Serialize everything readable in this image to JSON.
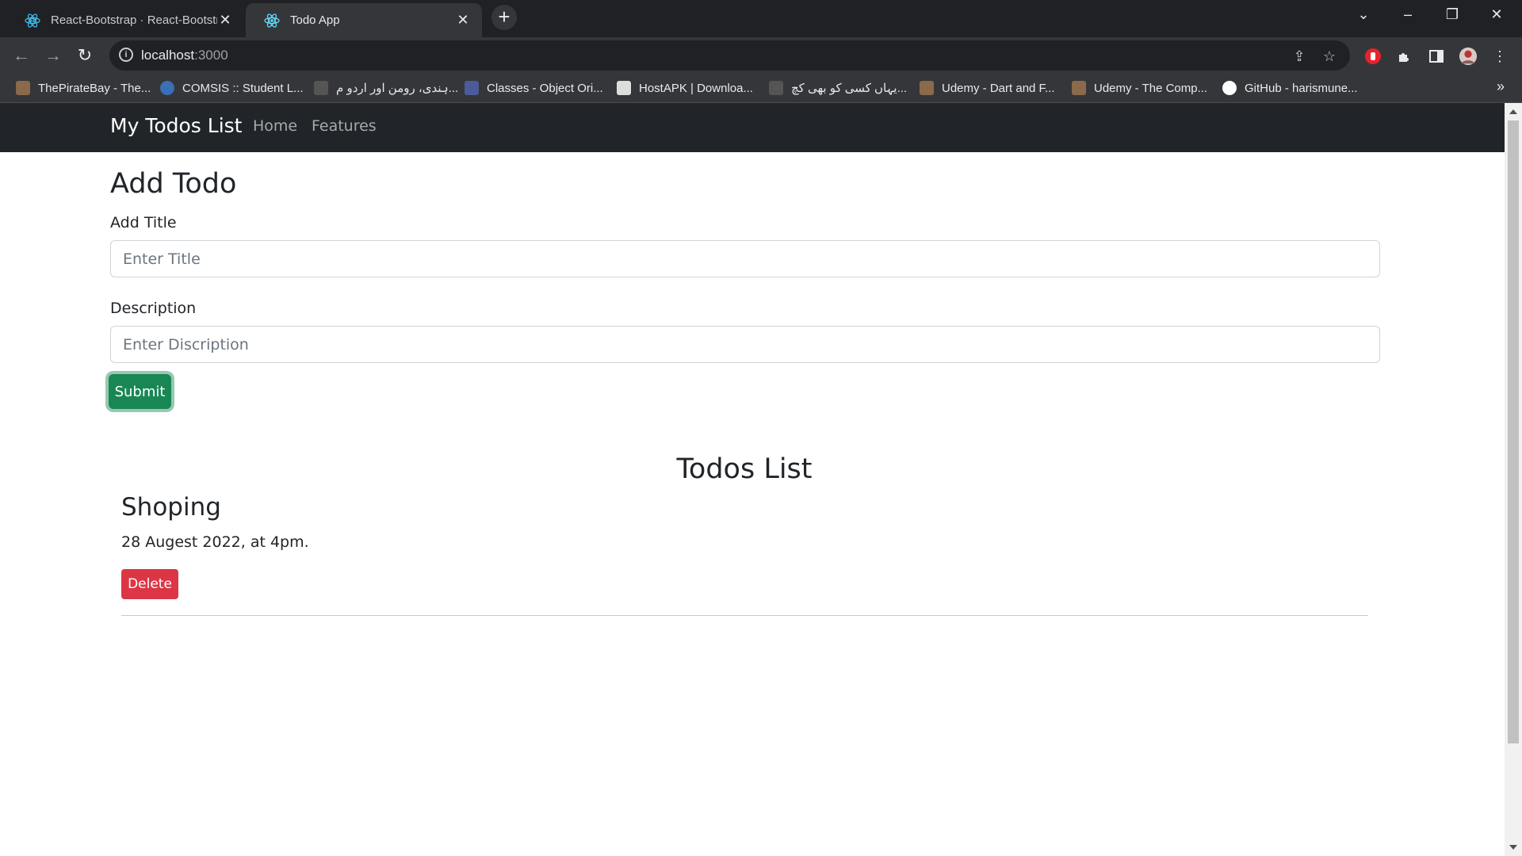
{
  "browser": {
    "tabs": [
      {
        "title": "React-Bootstrap · React-Bootstrap",
        "icon": "react-bootstrap-icon",
        "active": false
      },
      {
        "title": "Todo App",
        "icon": "react-icon",
        "active": true
      }
    ],
    "url_host": "localhost",
    "url_port": ":3000",
    "bookmarks": [
      {
        "label": "ThePirateBay - The...",
        "color": "#8a6a4a"
      },
      {
        "label": "COMSIS :: Student L...",
        "color": "#3b6fb6"
      },
      {
        "label": "ہندی، رومن اور اردو م...",
        "color": "#555555"
      },
      {
        "label": "Classes - Object Ori...",
        "color": "#4c5a9a"
      },
      {
        "label": "HostAPK | Downloa...",
        "color": "#dddddd"
      },
      {
        "label": "یہاں کسی کو بھی کچ...",
        "color": "#555555"
      },
      {
        "label": "Udemy - Dart and F...",
        "color": "#8a6a4a"
      },
      {
        "label": "Udemy - The Comp...",
        "color": "#8a6a4a"
      },
      {
        "label": "GitHub - harismune...",
        "color": "#ffffff"
      }
    ]
  },
  "navbar": {
    "brand": "My Todos List",
    "links": [
      "Home",
      "Features"
    ]
  },
  "add_form": {
    "heading": "Add Todo",
    "title_label": "Add Title",
    "title_placeholder": "Enter Title",
    "desc_label": "Description",
    "desc_placeholder": "Enter Discription",
    "submit_label": "Submit"
  },
  "todos": {
    "heading": "Todos List",
    "items": [
      {
        "title": "Shoping",
        "desc": "28 Augest 2022, at 4pm.",
        "delete_label": "Delete"
      }
    ]
  },
  "colors": {
    "navbar_bg": "#212529",
    "submit_bg": "#198754",
    "delete_bg": "#dc3545"
  }
}
